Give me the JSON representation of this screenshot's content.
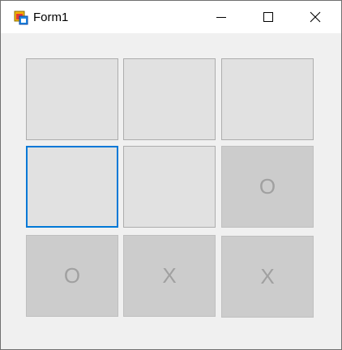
{
  "window": {
    "title": "Form1",
    "icon": "winforms-app-icon"
  },
  "caption_buttons": {
    "minimize_icon": "minimize-icon",
    "maximize_icon": "maximize-icon",
    "close_icon": "close-icon"
  },
  "board": {
    "focused_cell": 3,
    "cells": [
      {
        "mark": "",
        "taken": false
      },
      {
        "mark": "",
        "taken": false
      },
      {
        "mark": "",
        "taken": false
      },
      {
        "mark": "",
        "taken": false
      },
      {
        "mark": "",
        "taken": false
      },
      {
        "mark": "O",
        "taken": true
      },
      {
        "mark": "O",
        "taken": true
      },
      {
        "mark": "X",
        "taken": true
      },
      {
        "mark": "X",
        "taken": true
      }
    ]
  },
  "colors": {
    "focus_border": "#0078d7",
    "cell_background": "#e1e1e1",
    "taken_cell_background": "#cccccc",
    "mark_text": "#a0a0a0",
    "form_background": "#f0f0f0"
  }
}
